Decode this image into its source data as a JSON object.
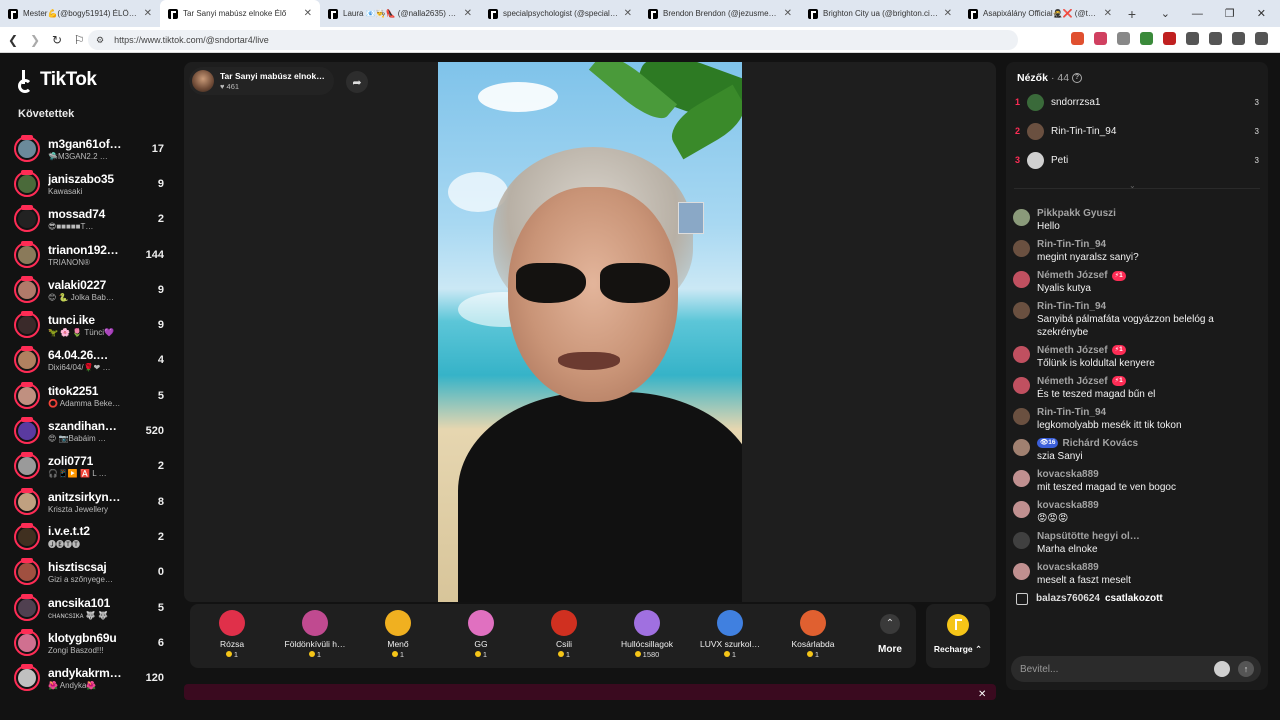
{
  "browser": {
    "tabs": [
      {
        "title": "Mester💪(@bogy51914) ÉLŐ a…",
        "active": false
      },
      {
        "title": "Tar Sanyi mabúsz elnoke Élő",
        "active": true
      },
      {
        "title": "Laura 📧👨‍🍳👠 (@nalla2635) ÉLŐ a…",
        "active": false
      },
      {
        "title": "specialpsychologist (@specialpsych…",
        "active": false
      },
      {
        "title": "Brendon Brendon (@jezusmegvalt…",
        "active": false
      },
      {
        "title": "Brighton City ua (@brighton.city) ÉL…",
        "active": false
      },
      {
        "title": "Asapixálány Official🥷❌ (@there…",
        "active": false
      }
    ],
    "url": "https://www.tiktok.com/@sndortar4/live"
  },
  "sidebar": {
    "brand": "TikTok",
    "following_title": "Követettek",
    "items": [
      {
        "name": "m3gan61of…",
        "sub": "🛸M3GAN2.2 …",
        "count": "17",
        "color": "#6b8a9a"
      },
      {
        "name": "janiszabo35",
        "sub": "Kawasaki",
        "count": "9",
        "color": "#4a6a3a"
      },
      {
        "name": "mossad74",
        "sub": "😎■■■■■T…",
        "count": "2",
        "color": "#222222"
      },
      {
        "name": "trianon192…",
        "sub": "TRIANON®",
        "count": "144",
        "color": "#8a7a5a"
      },
      {
        "name": "valaki0227",
        "sub": "😊 🐍 Jolka Bab…",
        "count": "9",
        "color": "#b07a6a"
      },
      {
        "name": "tunci.ike",
        "sub": "🦖 🌸 🌷 Tünci💜",
        "count": "9",
        "color": "#3a2a2a"
      },
      {
        "name": "64.04.26.…",
        "sub": "Dixi64/04/🌹❤ …",
        "count": "4",
        "color": "#b08060"
      },
      {
        "name": "titok2251",
        "sub": "⭕ Adamma Beke…",
        "count": "5",
        "color": "#c09080"
      },
      {
        "name": "szandihan…",
        "sub": "😍 📷Babáim …",
        "count": "520",
        "color": "#5a3aa0"
      },
      {
        "name": "zoli0771",
        "sub": "🎧📱▶️ 🅰️ L …",
        "count": "2",
        "color": "#9a9a9a"
      },
      {
        "name": "anitzsirkyn…",
        "sub": "Kriszta Jewellery",
        "count": "8",
        "color": "#c0a080"
      },
      {
        "name": "i.v.e.t.t2",
        "sub": "🅙🅔🅣🅣",
        "count": "2",
        "color": "#403020"
      },
      {
        "name": "hisztiscsaj",
        "sub": "Gizi a szőnyege…",
        "count": "0",
        "color": "#a05040"
      },
      {
        "name": "ancsika101",
        "sub": "ᴄʜᴀɴᴄsɪᴋᴀ 🐺 🐺",
        "count": "5",
        "color": "#504050"
      },
      {
        "name": "klotygbn69u",
        "sub": "Zongi Baszod!!!",
        "count": "6",
        "color": "#d07090"
      },
      {
        "name": "andykakrm…",
        "sub": "🌺 Andyka🌺",
        "count": "120",
        "color": "#c0c0c0"
      }
    ]
  },
  "stage": {
    "host_name": "Tar Sanyi mabúsz elnok…",
    "host_likes": "♥ 461"
  },
  "gifts": [
    {
      "name": "Rózsa",
      "price": "1",
      "color": "#e0304a"
    },
    {
      "name": "Földönkívüli h…",
      "price": "1",
      "color": "#c04a90"
    },
    {
      "name": "Menő",
      "price": "1",
      "color": "#f0b020"
    },
    {
      "name": "GG",
      "price": "1",
      "color": "#e070c0"
    },
    {
      "name": "Csili",
      "price": "1",
      "color": "#d03020"
    },
    {
      "name": "Hullócsillagok",
      "price": "1580",
      "color": "#a070e0"
    },
    {
      "name": "LUVX szurkol…",
      "price": "1",
      "color": "#4080e0"
    },
    {
      "name": "Kosárlabda",
      "price": "1",
      "color": "#e06030"
    }
  ],
  "more_label": "More",
  "recharge_label": "Recharge ⌃",
  "viewers": {
    "title": "Nézők",
    "count": "· 44",
    "top": [
      {
        "rank": "1",
        "name": "sndorrzsa1",
        "score": "3",
        "color": "#3a6a3a"
      },
      {
        "rank": "2",
        "name": "Rin-Tin-Tin_94",
        "score": "3",
        "color": "#6a5040"
      },
      {
        "rank": "3",
        "name": "Peti",
        "score": "3",
        "color": "#d0d0d0"
      }
    ]
  },
  "chat": [
    {
      "user": "Pikkpakk Gyuszi",
      "text": "Hello",
      "badge": "",
      "fan": "",
      "color": "#8a9a7a"
    },
    {
      "user": "Rin-Tin-Tin_94",
      "text": "megint nyaralsz sanyi?",
      "badge": "",
      "fan": "",
      "color": "#6a5040"
    },
    {
      "user": "Németh József",
      "text": "Nyalis kutya",
      "badge": "⚡1",
      "fan": "",
      "color": "#c05060"
    },
    {
      "user": "Rin-Tin-Tin_94",
      "text": "Sanyibá pálmafáta vogyázzon belelóg a szekrénybe",
      "badge": "",
      "fan": "",
      "color": "#6a5040"
    },
    {
      "user": "Németh József",
      "text": "Tőlünk is koldultal kenyere",
      "badge": "⚡1",
      "fan": "",
      "color": "#c05060"
    },
    {
      "user": "Németh József",
      "text": "És te teszed magad bűn el",
      "badge": "⚡1",
      "fan": "",
      "color": "#c05060"
    },
    {
      "user": "Rin-Tin-Tin_94",
      "text": "legkomolyabb mesék itt tik tokon",
      "badge": "",
      "fan": "",
      "color": "#6a5040"
    },
    {
      "user": "Richárd Kovács",
      "text": "szia Sanyi",
      "badge": "",
      "fan": "👁16",
      "color": "#a08070"
    },
    {
      "user": "kovacska889",
      "text": "mit teszed magad te ven bogoc",
      "badge": "",
      "fan": "",
      "color": "#c09090"
    },
    {
      "user": "kovacska889",
      "text": "😡😡😡",
      "badge": "",
      "fan": "",
      "color": "#c09090"
    },
    {
      "user": "Napsütötte hegyi ol…",
      "text": "Marha elnoke",
      "badge": "",
      "fan": "",
      "color": "#404040"
    },
    {
      "user": "kovacska889",
      "text": "meselt a faszt meselt",
      "badge": "",
      "fan": "",
      "color": "#c09090"
    }
  ],
  "joined": {
    "user": "balazs760624",
    "action": "csatlakozott"
  },
  "input": {
    "placeholder": "Bevitel..."
  }
}
